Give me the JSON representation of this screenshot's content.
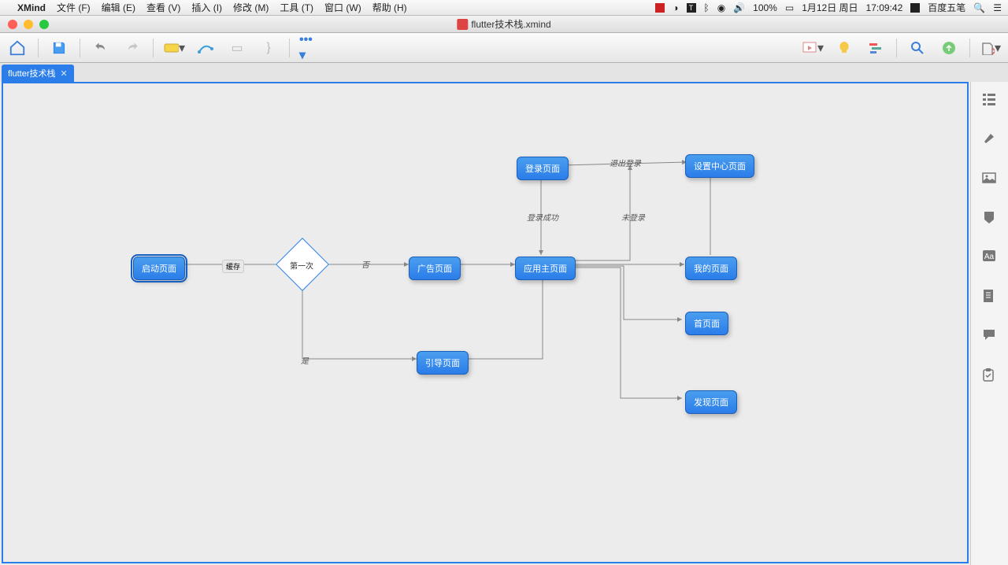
{
  "menubar": {
    "app": "XMind",
    "items": [
      "文件 (F)",
      "编辑 (E)",
      "查看 (V)",
      "插入 (I)",
      "修改 (M)",
      "工具 (T)",
      "窗口 (W)",
      "帮助 (H)"
    ],
    "status": {
      "battery": "100%",
      "date": "1月12日 周日",
      "time": "17:09:42",
      "ime": "百度五笔"
    }
  },
  "window": {
    "title": "flutter技术栈.xmind"
  },
  "tab": {
    "label": "flutter技术栈"
  },
  "nodes": {
    "start": "启动页面",
    "decision": "第一次",
    "ad": "广告页面",
    "guide": "引导页面",
    "main": "应用主页面",
    "login": "登录页面",
    "settings": "设置中心页面",
    "mine": "我的页面",
    "home": "首页面",
    "discover": "发现页面"
  },
  "edge_labels": {
    "save": "缓存",
    "no": "否",
    "yes": "是",
    "login_ok": "登录成功",
    "logout": "退出登录",
    "not_login": "未登录"
  }
}
